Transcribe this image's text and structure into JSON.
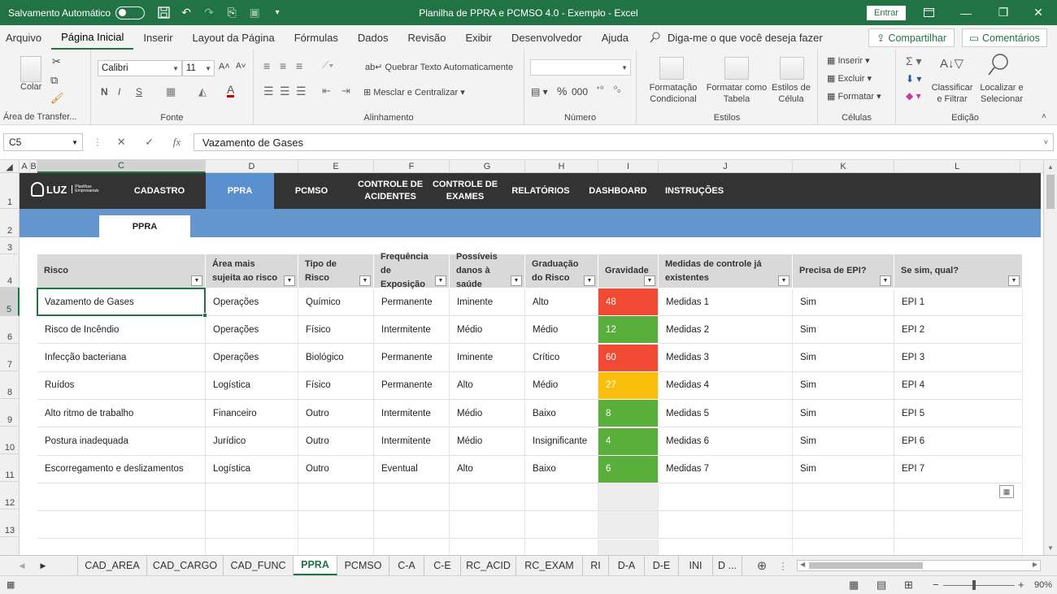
{
  "titlebar": {
    "autosave_label": "Salvamento Automático",
    "doc_title": "Planilha de PPRA e PCMSO 4.0 - Exemplo  -  Excel",
    "signin_label": "Entrar"
  },
  "menu": {
    "tabs": [
      "Arquivo",
      "Página Inicial",
      "Inserir",
      "Layout da Página",
      "Fórmulas",
      "Dados",
      "Revisão",
      "Exibir",
      "Desenvolvedor",
      "Ajuda"
    ],
    "tell_me": "Diga-me o que você deseja fazer",
    "share_label": "Compartilhar",
    "comments_label": "Comentários"
  },
  "ribbon": {
    "clipboard": {
      "paste": "Colar",
      "label": "Área de Transfer..."
    },
    "font": {
      "name": "Calibri",
      "size": "11",
      "bold": "N",
      "italic": "I",
      "underline": "S",
      "label": "Fonte"
    },
    "alignment": {
      "wrap": "Quebrar Texto Automaticamente",
      "merge": "Mesclar e Centralizar",
      "label": "Alinhamento"
    },
    "number": {
      "format": "",
      "label": "Número"
    },
    "styles": {
      "conditional": "Formatação Condicional",
      "as_table": "Formatar como Tabela",
      "cell_styles": "Estilos de Célula",
      "label": "Estilos"
    },
    "cells": {
      "insert": "Inserir",
      "delete": "Excluir",
      "format": "Formatar",
      "label": "Células"
    },
    "editing": {
      "sort": "Classificar e Filtrar",
      "find": "Localizar e Selecionar",
      "label": "Edição"
    }
  },
  "formula_bar": {
    "name_box": "C5",
    "fx": "fx",
    "value": "Vazamento de Gases"
  },
  "columns": [
    "A",
    "B",
    "C",
    "D",
    "E",
    "F",
    "G",
    "H",
    "I",
    "J",
    "K",
    "L"
  ],
  "rows": [
    "1",
    "2",
    "3",
    "4",
    "5",
    "6",
    "7",
    "8",
    "9",
    "10",
    "11",
    "12",
    "13"
  ],
  "app_nav": {
    "logo": "LUZ",
    "logo_sub": "Planilhas Empresariais",
    "items": [
      "CADASTRO",
      "PPRA",
      "PCMSO",
      "CONTROLE DE ACIDENTES",
      "CONTROLE DE EXAMES",
      "RELATÓRIOS",
      "DASHBOARD",
      "INSTRUÇÕES"
    ],
    "page_tab": "PPRA"
  },
  "table": {
    "headers": [
      "Risco",
      "Área mais sujeita ao risco",
      "Tipo de Risco",
      "Frequência de Exposição",
      "Possíveis danos à saúde",
      "Graduação do Risco",
      "Gravidade",
      "Medidas de controle já existentes",
      "Precisa de EPI?",
      "Se sim, qual?"
    ],
    "rows": [
      [
        "Vazamento de Gases",
        "Operações",
        "Químico",
        "Permanente",
        "Iminente",
        "Alto",
        "48",
        "Medidas 1",
        "Sim",
        "EPI 1"
      ],
      [
        "Risco de Incêndio",
        "Operações",
        "Físico",
        "Intermitente",
        "Médio",
        "Médio",
        "12",
        "Medidas 2",
        "Sim",
        "EPI 2"
      ],
      [
        "Infecção bacteriana",
        "Operações",
        "Biológico",
        "Permanente",
        "Iminente",
        "Crítico",
        "60",
        "Medidas 3",
        "Sim",
        "EPI 3"
      ],
      [
        "Ruídos",
        "Logística",
        "Físico",
        "Permanente",
        "Alto",
        "Médio",
        "27",
        "Medidas 4",
        "Sim",
        "EPI 4"
      ],
      [
        "Alto ritmo de trabalho",
        "Financeiro",
        "Outro",
        "Intermitente",
        "Médio",
        "Baixo",
        "8",
        "Medidas 5",
        "Sim",
        "EPI 5"
      ],
      [
        "Postura inadequada",
        "Jurídico",
        "Outro",
        "Intermitente",
        "Médio",
        "Insignificante",
        "4",
        "Medidas 6",
        "Sim",
        "EPI 6"
      ],
      [
        "Escorregamento e deslizamentos",
        "Logística",
        "Outro",
        "Eventual",
        "Alto",
        "Baixo",
        "6",
        "Medidas 7",
        "Sim",
        "EPI 7"
      ]
    ],
    "gravity_colors": [
      "#f04a35",
      "#5aae3c",
      "#f04a35",
      "#f9bf0a",
      "#5aae3c",
      "#5aae3c",
      "#5aae3c"
    ]
  },
  "sheet_tabs": [
    "CAD_AREA",
    "CAD_CARGO",
    "CAD_FUNC",
    "PPRA",
    "PCMSO",
    "C-A",
    "C-E",
    "RC_ACID",
    "RC_EXAM",
    "RI",
    "D-A",
    "D-E",
    "INI",
    "D ..."
  ],
  "active_sheet": "PPRA",
  "status": {
    "zoom": "90%"
  },
  "colors": {
    "excel_green": "#217346",
    "nav_dark": "#333333",
    "nav_blue": "#6495cc"
  }
}
